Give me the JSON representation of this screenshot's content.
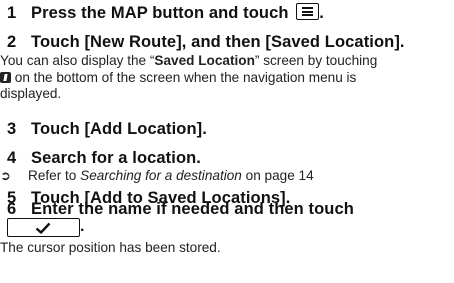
{
  "steps": [
    {
      "num": "1",
      "text": "Press the MAP button and touch ",
      "suffix": "."
    },
    {
      "num": "2",
      "text": "Touch [New Route], and then [Saved Location]."
    },
    {
      "num": "3",
      "text": "Touch [Add Location]."
    },
    {
      "num": "4",
      "text": "Search for a location."
    },
    {
      "num": "5",
      "text": "Touch [Add to Saved Locations]."
    },
    {
      "num": "6",
      "text": "Enter the name if needed and then touch",
      "suffix": "."
    }
  ],
  "note": {
    "part1": "You can also display the “",
    "term": "Saved Location",
    "part2": "” screen by touching",
    "part3": " on the bottom of the screen when the navigation menu is",
    "part4": "displayed."
  },
  "reference": {
    "arrow": "➲",
    "prefix": "Refer to ",
    "link": "Searching for a destination",
    "suffix": " on page 14"
  },
  "result": "The cursor position has been stored."
}
